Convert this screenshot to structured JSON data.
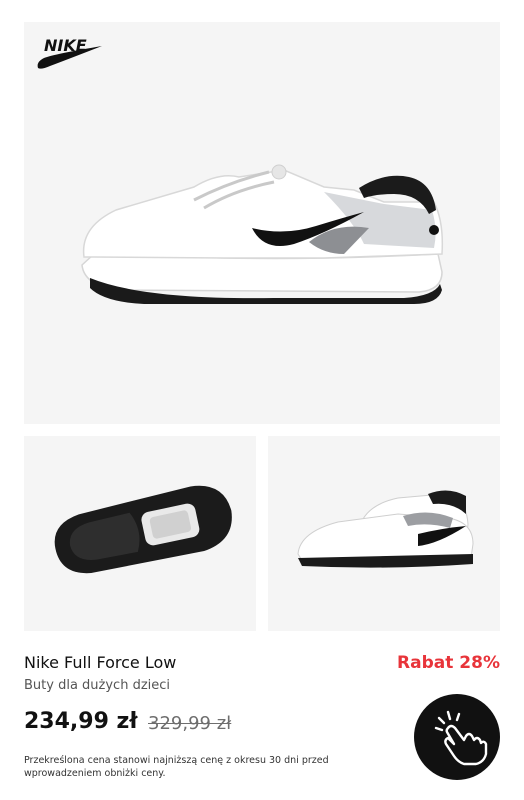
{
  "brand": {
    "logo_text": "NIKE"
  },
  "product": {
    "name": "Nike Full Force Low",
    "category": "Buty dla dużych dzieci",
    "discount": "Rabat 28%",
    "price": "234,99 zł",
    "old_price": "329,99 zł",
    "price_note": "Przekreślona cena stanowi najniższą cenę z okresu 30 dni przed wprowadzeniem obniżki ceny."
  },
  "colors": {
    "accent_red": "#e8343a",
    "panel_bg": "#f5f5f5",
    "button_bg": "#111111"
  },
  "icons": {
    "tap": "tap-hand-icon",
    "logo": "nike-swoosh-icon"
  }
}
